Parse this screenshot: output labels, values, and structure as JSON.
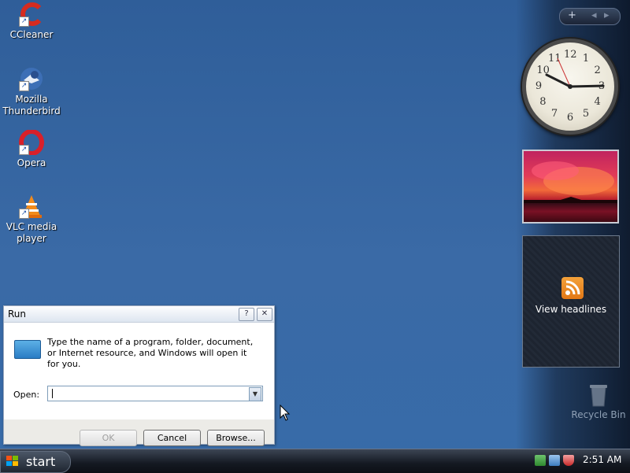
{
  "desktop": {
    "icons": [
      {
        "label": "CCleaner"
      },
      {
        "label": "Mozilla Thunderbird"
      },
      {
        "label": "Opera"
      },
      {
        "label": "VLC media player"
      }
    ],
    "recycle_bin": "Recycle Bin"
  },
  "sidebar": {
    "controls": {
      "add": "+",
      "prev": "◂",
      "next": "▸"
    },
    "clock": {
      "numbers": [
        "12",
        "1",
        "2",
        "3",
        "4",
        "5",
        "6",
        "7",
        "8",
        "9",
        "10",
        "11"
      ],
      "hour_hand": "3",
      "minute_hand": "10"
    },
    "feed": {
      "label": "View headlines"
    }
  },
  "run_dialog": {
    "title": "Run",
    "help_button": "?",
    "close_button": "✕",
    "description": "Type the name of a program, folder, document, or Internet resource, and Windows will open it for you.",
    "open_label": "Open:",
    "open_value": "",
    "ok_label": "OK",
    "cancel_label": "Cancel",
    "browse_label": "Browse...",
    "accent_color": "#2a7cc4"
  },
  "taskbar": {
    "start_label": "start",
    "clock": "2:51 AM"
  }
}
